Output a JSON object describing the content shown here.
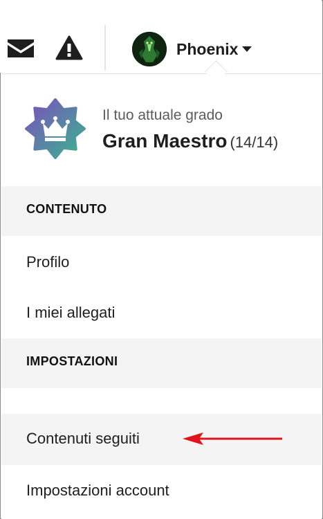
{
  "header": {
    "mail_icon": "envelope-icon",
    "alert_icon": "warning-triangle-icon",
    "username": "Phoenix",
    "caret_icon": "caret-down-icon"
  },
  "rank": {
    "caption": "Il tuo attuale grado",
    "title": "Gran Maestro",
    "progress": "(14/14)",
    "badge_icon": "crown-badge-icon"
  },
  "sections": {
    "content_header": "CONTENUTO",
    "settings_header": "IMPOSTAZIONI"
  },
  "menu": {
    "profile": "Profilo",
    "attachments": "I miei allegati",
    "followed": "Contenuti seguiti",
    "account_settings": "Impostazioni account"
  },
  "colors": {
    "accent_arrow": "#e0151b",
    "badge_gradient_start": "#7b4fc0",
    "badge_gradient_end": "#3bb58c",
    "section_background": "#f4f4f4"
  }
}
